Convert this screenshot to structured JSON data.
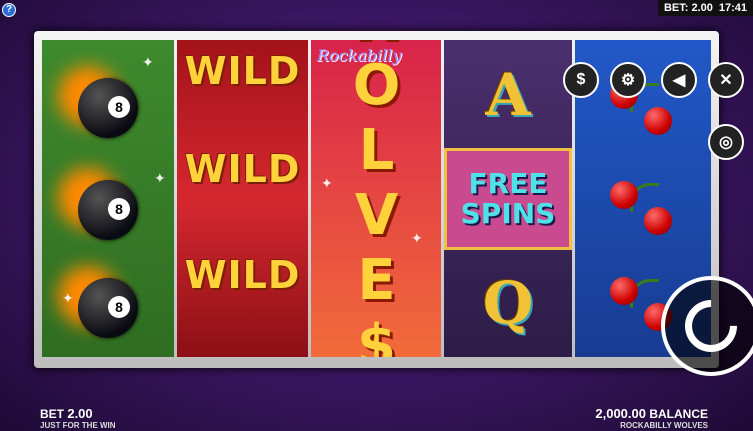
{
  "topbar": {
    "bet": "BET: 2.00",
    "clock": "17:41"
  },
  "help_label": "?",
  "reels": {
    "reel2_symbol": "WILD",
    "reel3_title": "Rockabilly",
    "reel3_main": "WOLVE$!",
    "reel4_top": "A",
    "reel4_free1": "FREE",
    "reel4_free2": "SPINS",
    "reel4_bottom": "Q",
    "reel1_ball_number": "8"
  },
  "controls": {
    "coin_icon": "dollar-star-icon",
    "settings_icon": "gear-icon",
    "sound_icon": "speaker-icon",
    "close_icon": "close-icon",
    "autoplay_icon": "autoplay-icon"
  },
  "bottom": {
    "bet_label": "BET",
    "bet_value": "2.00",
    "bet_sub": "JUST FOR THE WIN",
    "balance_value": "2,000.00",
    "balance_label": "BALANCE",
    "balance_sub": "ROCKABILLY WOLVES"
  }
}
